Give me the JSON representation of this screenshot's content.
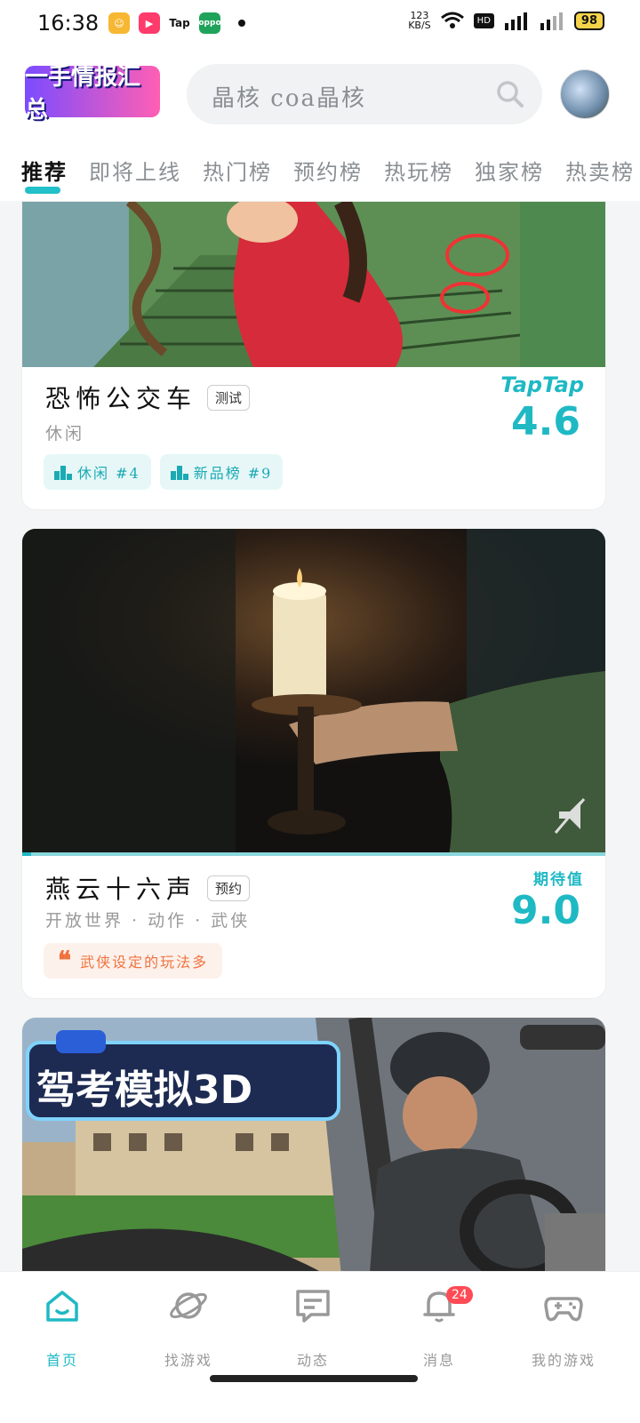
{
  "status_bar": {
    "time": "16:38",
    "app_icons": [
      "Tap",
      "oppo"
    ],
    "network_speed": "123\nKB/S",
    "battery": "98"
  },
  "header": {
    "logo_text": "一手情报汇总",
    "search_placeholder": "晶核 coa晶核"
  },
  "tabs": [
    {
      "label": "推荐",
      "active": true
    },
    {
      "label": "即将上线"
    },
    {
      "label": "热门榜"
    },
    {
      "label": "预约榜"
    },
    {
      "label": "热玩榜"
    },
    {
      "label": "独家榜"
    },
    {
      "label": "热卖榜"
    }
  ],
  "cards": [
    {
      "title": "恐怖公交车",
      "badge": "测试",
      "genre": "休闲",
      "score_brand": "TapTap",
      "score": "4.6",
      "chips": [
        "休闲 #4",
        "新品榜 #9"
      ]
    },
    {
      "title": "燕云十六声",
      "badge": "预约",
      "genre": "开放世界 · 动作 · 武侠",
      "score_label": "期待值",
      "score": "9.0",
      "quote": "武侠设定的玩法多"
    },
    {
      "banner_text": "驾考模拟3D"
    }
  ],
  "bottom_nav": [
    {
      "label": "首页",
      "icon": "home-icon",
      "active": true
    },
    {
      "label": "找游戏",
      "icon": "planet-icon"
    },
    {
      "label": "动态",
      "icon": "chat-icon"
    },
    {
      "label": "消息",
      "icon": "bell-icon",
      "badge": "24"
    },
    {
      "label": "我的游戏",
      "icon": "gamepad-icon"
    }
  ],
  "colors": {
    "accent": "#1fb9c4",
    "quote": "#f0733f",
    "badge_red": "#ff4b55"
  }
}
